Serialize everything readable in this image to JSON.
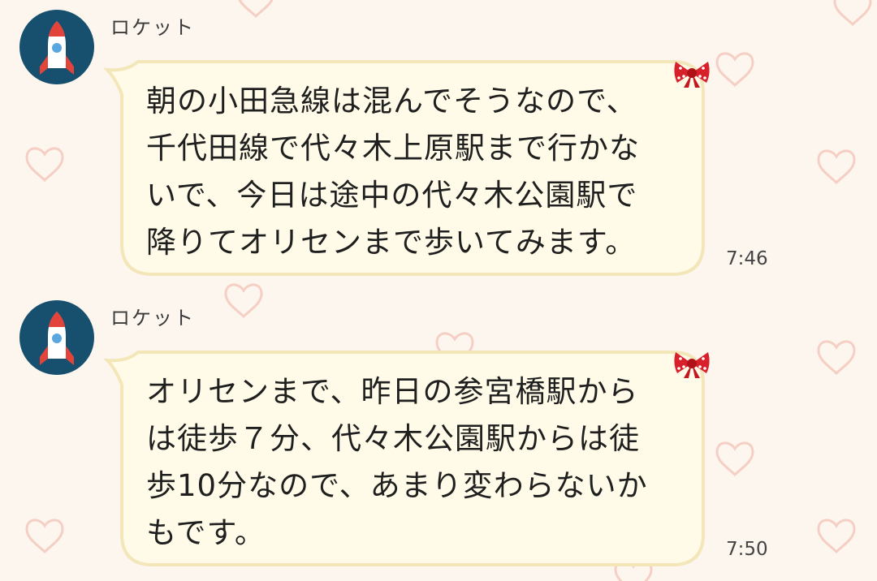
{
  "colors": {
    "background": "#fdf6ef",
    "bubble_fill": "#fffbe8",
    "bubble_border": "#f3e6b8",
    "avatar_bg": "#16506e",
    "heart": "#f5cfc4",
    "ribbon": "#d8202a"
  },
  "messages": [
    {
      "sender": "ロケット",
      "avatar_icon": "rocket-icon",
      "text": "朝の小田急線は混んでそうなので、\n千代田線で代々木上原駅まで行かな\nいで、今日は途中の代々木公園駅で\n降りてオリセンまで歩いてみます。",
      "time": "7:46"
    },
    {
      "sender": "ロケット",
      "avatar_icon": "rocket-icon",
      "text": "オリセンまで、昨日の参宮橋駅から\nは徒歩７分、代々木公園駅からは徒\n歩10分なので、あまり変わらないか\nもです。",
      "time": "7:50"
    }
  ]
}
